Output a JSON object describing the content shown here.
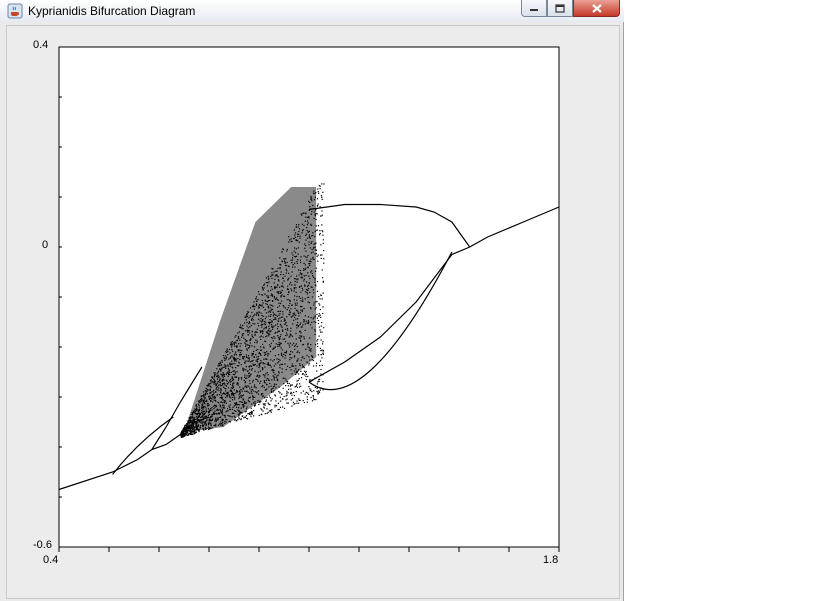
{
  "window": {
    "title": "Kyprianidis Bifurcation Diagram",
    "icons": {
      "app": "java-cup-icon",
      "minimize": "minimize-icon",
      "maximize": "maximize-icon",
      "close": "close-icon"
    }
  },
  "chart_data": {
    "type": "scatter",
    "title": "",
    "xlabel": "",
    "ylabel": "",
    "xlim": [
      0.4,
      1.8
    ],
    "ylim": [
      -0.6,
      0.4
    ],
    "x_tick_labels": [
      "0.4",
      "1.8"
    ],
    "y_tick_labels": [
      "0.4",
      "0",
      "-0.6"
    ],
    "grid": false,
    "point_color": "#000000",
    "series": [
      {
        "curves": [
          {
            "x": [
              0.4,
              0.55,
              0.62,
              0.66,
              0.7,
              0.74,
              0.78,
              0.82
            ],
            "y": [
              -0.485,
              -0.45,
              -0.425,
              -0.405,
              -0.395,
              -0.375,
              -0.35,
              -0.34
            ]
          },
          {
            "x": [
              0.66,
              0.7,
              0.74,
              0.77,
              0.8
            ],
            "y": [
              -0.405,
              -0.36,
              -0.31,
              -0.275,
              -0.24
            ]
          },
          {
            "x": [
              1.1,
              1.2,
              1.3,
              1.4,
              1.5,
              1.55,
              1.6,
              1.7,
              1.8
            ],
            "y": [
              -0.27,
              -0.23,
              -0.18,
              -0.11,
              -0.015,
              0.0,
              0.02,
              0.05,
              0.08
            ]
          },
          {
            "x": [
              1.1,
              1.2,
              1.3,
              1.4,
              1.45,
              1.5,
              1.55
            ],
            "y": [
              0.075,
              0.085,
              0.085,
              0.08,
              0.07,
              0.05,
              0.0
            ]
          }
        ]
      }
    ]
  }
}
